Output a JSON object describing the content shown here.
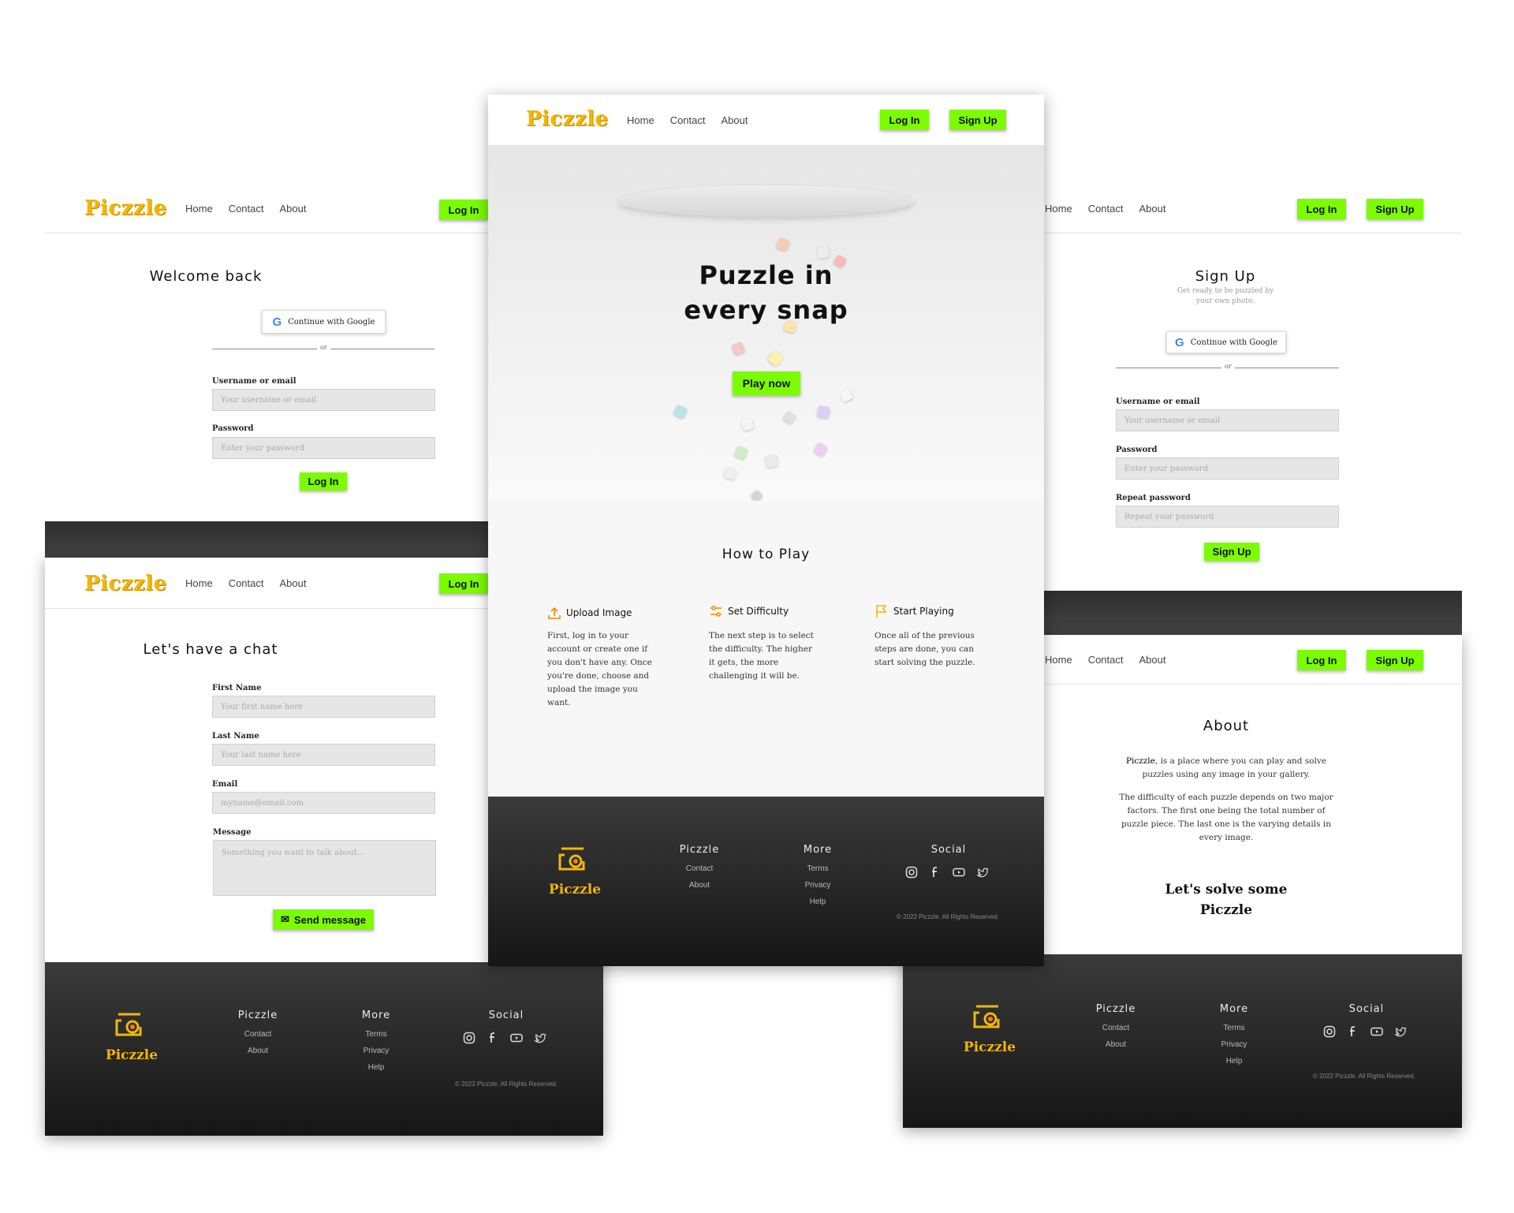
{
  "brand": {
    "name": "Piczzle",
    "accent": "#7cfc00",
    "logo_color": "#f2b705"
  },
  "nav": {
    "home": "Home",
    "contact": "Contact",
    "about": "About",
    "login": "Log In",
    "signup": "Sign Up"
  },
  "login_page": {
    "title": "Welcome back",
    "google": "Continue with Google",
    "or": "or",
    "username_label": "Username or email",
    "username_placeholder": "Your username or email",
    "password_label": "Password",
    "password_placeholder": "Enter your password",
    "submit": "Log In"
  },
  "signup_page": {
    "title": "Sign Up",
    "subtitle_line1": "Get ready to be puzzled by",
    "subtitle_line2": "your own photo.",
    "google": "Continue with Google",
    "or": "or",
    "username_label": "Username or email",
    "username_placeholder": "Your username or email",
    "password_label": "Password",
    "password_placeholder": "Enter your password",
    "repeat_label": "Repeat password",
    "repeat_placeholder": "Repeat your password",
    "submit": "Sign Up"
  },
  "contact_page": {
    "title": "Let's have a chat",
    "first_label": "First Name",
    "first_placeholder": "Your first name here",
    "last_label": "Last Name",
    "last_placeholder": "Your last name here",
    "email_label": "Email",
    "email_placeholder": "myname@email.com",
    "message_label": "Message",
    "message_placeholder": "Something you want to talk about...",
    "submit": "Send message"
  },
  "home_page": {
    "hero_line1": "Puzzle in",
    "hero_line2": "every snap",
    "play": "Play now",
    "how_title": "How to Play",
    "steps": [
      {
        "title": "Upload Image",
        "text": [
          "First, log in to your",
          "account or create one if",
          "you don't have any. Once",
          "you're done, choose and",
          "upload the image you",
          "want."
        ]
      },
      {
        "title": "Set Difficulty",
        "text": [
          "The next step is to select",
          "the difficulty. The higher",
          "it gets, the more",
          "challenging it will be."
        ]
      },
      {
        "title": "Start Playing",
        "text": [
          "Once all of the previous",
          "steps are done, you can",
          "start solving the puzzle."
        ]
      }
    ]
  },
  "about_page": {
    "title": "About",
    "p1_brand": "Piczzle",
    "p1_rest": ", is a place where you can play and solve",
    "p1_line2": "puzzles using any image in your gallery.",
    "p2": [
      "The difficulty of each puzzle depends on two major",
      "factors. The first one being the total number of",
      "puzzle piece. The last one is the varying details in",
      "every image."
    ],
    "tagline1": "Let's solve some",
    "tagline2": "Piczzle"
  },
  "footer": {
    "col1_title": "Piczzle",
    "col1_items": [
      "Contact",
      "About"
    ],
    "col2_title": "More",
    "col2_items": [
      "Terms",
      "Privacy",
      "Help"
    ],
    "col3_title": "Social",
    "social_icons": [
      "instagram-icon",
      "facebook-icon",
      "youtube-icon",
      "twitter-icon"
    ],
    "copyright": "© 2022 Piczzle. All Rights Reserved."
  }
}
